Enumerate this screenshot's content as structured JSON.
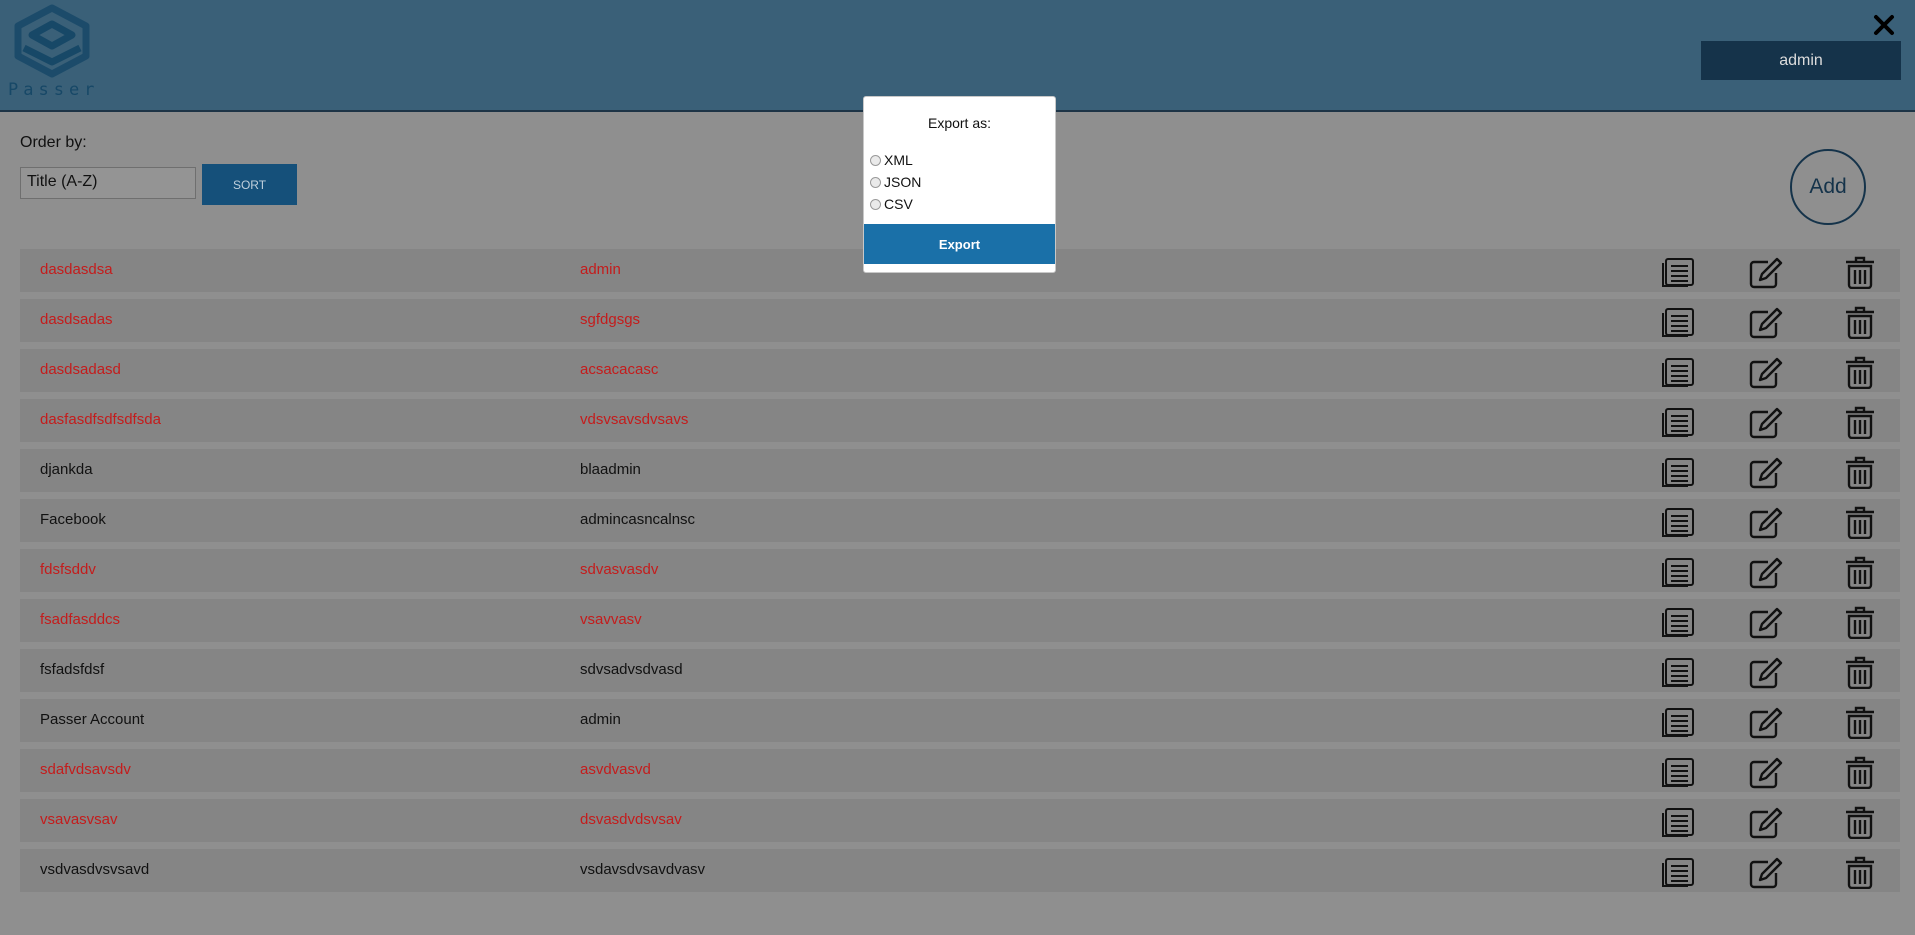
{
  "header": {
    "logo_text": "Passer",
    "user_label": "admin",
    "close_icon": "close-x-icon"
  },
  "toolbar": {
    "order_label": "Order by:",
    "order_value": "Title (A-Z)",
    "sort_label": "SORT",
    "add_label": "Add"
  },
  "colors": {
    "header_bg": "#3a6078",
    "accent": "#1a70a8",
    "highlight_text": "#c41c1c"
  },
  "entries": [
    {
      "title": "dasdasdsa",
      "username": "admin",
      "highlight": true
    },
    {
      "title": "dasdsadas",
      "username": "sgfdgsgs",
      "highlight": true
    },
    {
      "title": "dasdsadasd",
      "username": "acsacacasc",
      "highlight": true
    },
    {
      "title": "dasfasdfsdfsdfsda",
      "username": "vdsvsavsdvsavs",
      "highlight": true
    },
    {
      "title": "djankda",
      "username": "blaadmin",
      "highlight": false
    },
    {
      "title": "Facebook",
      "username": "admincasncalnsc",
      "highlight": false
    },
    {
      "title": "fdsfsddv",
      "username": "sdvasvasdv",
      "highlight": true
    },
    {
      "title": "fsadfasddcs",
      "username": "vsavvasv",
      "highlight": true
    },
    {
      "title": "fsfadsfdsf",
      "username": "sdvsadvsdvasd",
      "highlight": false
    },
    {
      "title": "Passer Account",
      "username": "admin",
      "highlight": false
    },
    {
      "title": "sdafvdsavsdv",
      "username": "asvdvasvd",
      "highlight": true
    },
    {
      "title": "vsavasvsav",
      "username": "dsvasdvdsvsav",
      "highlight": true
    },
    {
      "title": "vsdvasdvsvsavd",
      "username": "vsdavsdvsavdvasv",
      "highlight": false
    }
  ],
  "row_icons": [
    "view-icon",
    "edit-icon",
    "trash-icon"
  ],
  "export_modal": {
    "title": "Export as:",
    "options": [
      "XML",
      "JSON",
      "CSV"
    ],
    "button_label": "Export"
  }
}
